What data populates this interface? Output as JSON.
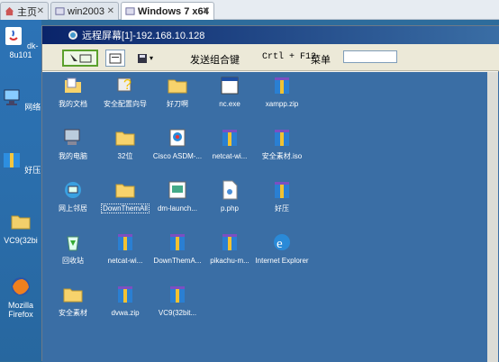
{
  "tabs": [
    {
      "label": "主页",
      "active": false
    },
    {
      "label": "win2003",
      "active": false
    },
    {
      "label": "Windows 7 x64",
      "active": true
    }
  ],
  "host_icons": [
    {
      "label": "dk-8u101",
      "icon": "java-installer-icon"
    },
    {
      "label": "网络",
      "icon": "network-icon"
    },
    {
      "label": "好压",
      "icon": "haozip-icon"
    },
    {
      "label": "VC9(32bi",
      "icon": "folder-icon"
    },
    {
      "label": "Mozilla Firefox",
      "icon": "firefox-icon"
    }
  ],
  "remote": {
    "title": "远程屏幕[1]-192.168.10.128",
    "toolbar": {
      "send_combo_label": "发送组合键",
      "shortcut_label": "Crtl + F12",
      "menu_label": "菜单",
      "menu_input_value": ""
    },
    "desktop": [
      {
        "label": "我的文档",
        "icon": "my-documents-icon"
      },
      {
        "label": "安全配置向导",
        "icon": "security-wizard-icon"
      },
      {
        "label": "好刀啊",
        "icon": "folder-icon"
      },
      {
        "label": "nc.exe",
        "icon": "exe-window-icon"
      },
      {
        "label": "xampp.zip",
        "icon": "zip-archive-icon"
      },
      {
        "label": "我的电脑",
        "icon": "my-computer-icon"
      },
      {
        "label": "32位",
        "icon": "folder-icon"
      },
      {
        "label": "Cisco ASDM-...",
        "icon": "cisco-asdm-icon"
      },
      {
        "label": "netcat-wi...",
        "icon": "zip-archive-icon"
      },
      {
        "label": "安全素材.iso",
        "icon": "iso-archive-icon"
      },
      {
        "label": "网上邻居",
        "icon": "network-places-icon"
      },
      {
        "label": "DownThemAll",
        "icon": "folder-icon"
      },
      {
        "label": "dm-launch...",
        "icon": "dm-launcher-icon"
      },
      {
        "label": "p.php",
        "icon": "php-file-icon"
      },
      {
        "label": "好压",
        "icon": "zip-archive-icon"
      },
      {
        "label": "回收站",
        "icon": "recycle-bin-icon"
      },
      {
        "label": "netcat-wi...",
        "icon": "zip-archive-icon"
      },
      {
        "label": "DownThemA...",
        "icon": "zip-archive-icon"
      },
      {
        "label": "pikachu-m...",
        "icon": "zip-archive-icon"
      },
      {
        "label": "Internet Explorer",
        "icon": "internet-explorer-icon"
      },
      {
        "label": "安全素材",
        "icon": "folder-icon"
      },
      {
        "label": "dvwa.zip",
        "icon": "zip-archive-icon"
      },
      {
        "label": "VC9(32bit...",
        "icon": "zip-archive-icon"
      }
    ]
  }
}
